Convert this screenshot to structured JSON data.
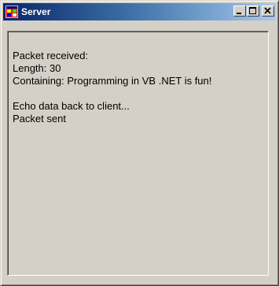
{
  "window": {
    "title": "Server",
    "icon": "windows-form-icon",
    "caption_buttons": [
      "minimize-icon",
      "maximize-icon",
      "close-icon"
    ]
  },
  "log": {
    "lines": [
      "Packet received:",
      "Length: 30",
      "Containing: Programming in VB .NET is fun!",
      "",
      "Echo data back to client...",
      "Packet sent"
    ]
  },
  "colors": {
    "window_face": "#d4d0c8",
    "titlebar_start": "#0a246a",
    "titlebar_end": "#a6caf0",
    "title_text": "#ffffff"
  }
}
